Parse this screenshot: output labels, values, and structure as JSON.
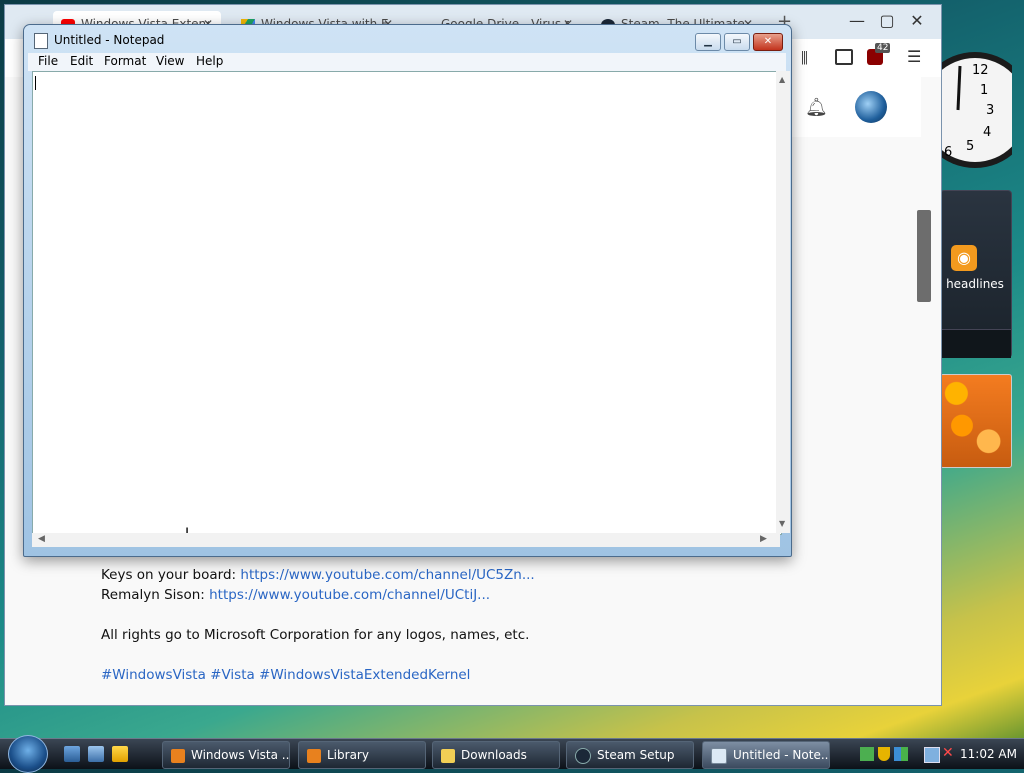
{
  "browser": {
    "tabs": [
      {
        "label": "Windows Vista Extended",
        "icon": "youtube-icon",
        "color": "#ff0000"
      },
      {
        "label": "Windows Vista with Ex",
        "icon": "google-drive-icon",
        "color": "#f2b705"
      },
      {
        "label": "Google Drive - Virus scan",
        "icon": "",
        "color": ""
      },
      {
        "label": "Steam, The Ultimate O",
        "icon": "steam-icon",
        "color": "#1b2838"
      }
    ],
    "new_tab": "+",
    "badge_count": "42",
    "description_lines": [
      {
        "prefix": "Keys on your board: ",
        "link": "https://www.youtube.com/channel/UC5Zn..."
      },
      {
        "prefix": "Remalyn Sison: ",
        "link": "https://www.youtube.com/channel/UCtiJ..."
      }
    ],
    "rights": "All rights go to Microsoft Corporation for any logos, names, etc.",
    "hashtags": "#WindowsVista #Vista #WindowsVistaExtendedKernel"
  },
  "notepad": {
    "title": "Untitled - Notepad",
    "menu": [
      "File",
      "Edit",
      "Format",
      "View",
      "Help"
    ]
  },
  "gadgets": {
    "feed_label": "headlines"
  },
  "taskbar": {
    "items": [
      {
        "label": "Windows Vista ...",
        "icon": "firefox-icon"
      },
      {
        "label": "Library",
        "icon": "firefox-icon"
      },
      {
        "label": "Downloads",
        "icon": "folder-icon"
      },
      {
        "label": "Steam Setup",
        "icon": "steam-icon"
      },
      {
        "label": "Untitled - Note...",
        "icon": "notepad-icon"
      }
    ],
    "time": "11:02 AM"
  }
}
